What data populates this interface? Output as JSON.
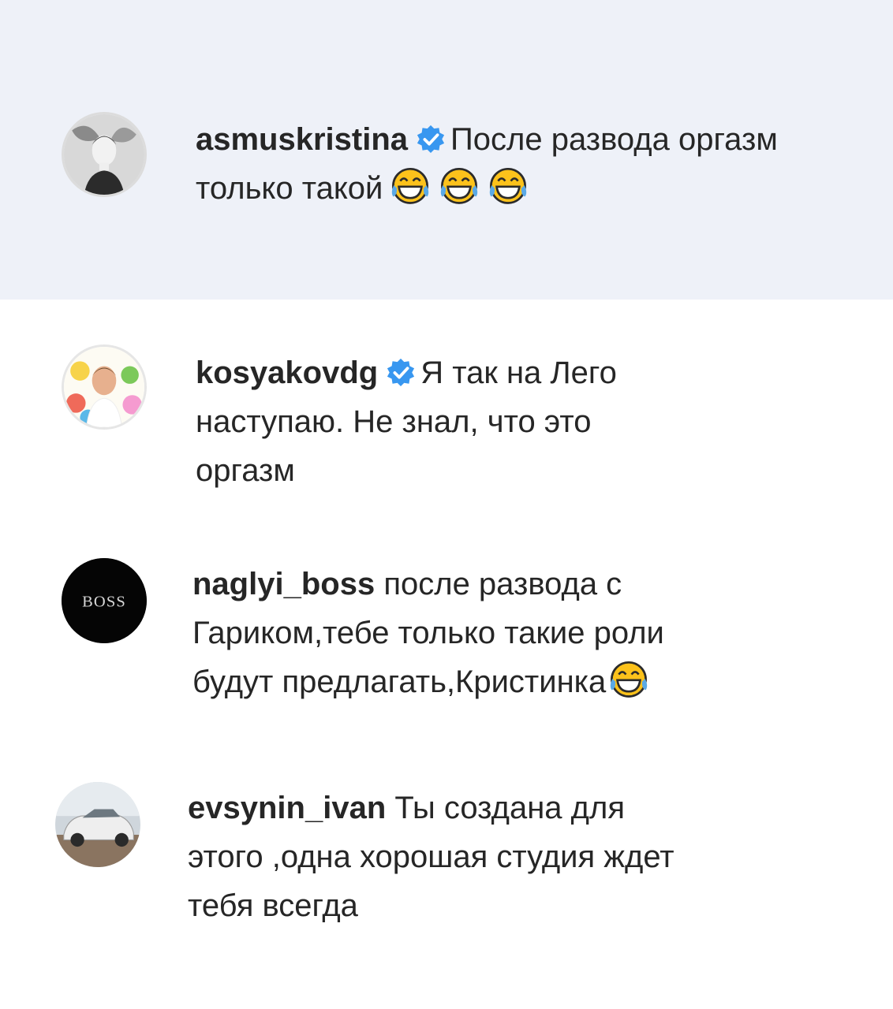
{
  "comments": [
    {
      "username": "asmuskristina",
      "verified": true,
      "text": "После развода оргазм только такой",
      "emojis": [
        "face-with-tears-of-joy-icon",
        "face-with-tears-of-joy-icon",
        "face-with-tears-of-joy-icon"
      ],
      "highlighted": true
    },
    {
      "username": "kosyakovdg",
      "verified": true,
      "text_lines": [
        "Я так на Лего",
        "наступаю. Не знал, что это",
        "оргазм"
      ]
    },
    {
      "username": "naglyi_boss",
      "verified": false,
      "avatar_text": "BOSS",
      "text_lines": [
        "после развода с",
        "Гариком,тебе только такие роли",
        "будут предлагать,Кристинка"
      ],
      "emojis": [
        "face-with-tears-of-joy-icon"
      ]
    },
    {
      "username": "evsynin_ivan",
      "verified": false,
      "text_lines": [
        "Ты создана для",
        "этого ,одна хорошая студия ждет",
        "тебя всегда"
      ]
    }
  ],
  "colors": {
    "highlight_bg": "#eef1f8",
    "verified_blue": "#3897f0",
    "text": "#262626"
  }
}
